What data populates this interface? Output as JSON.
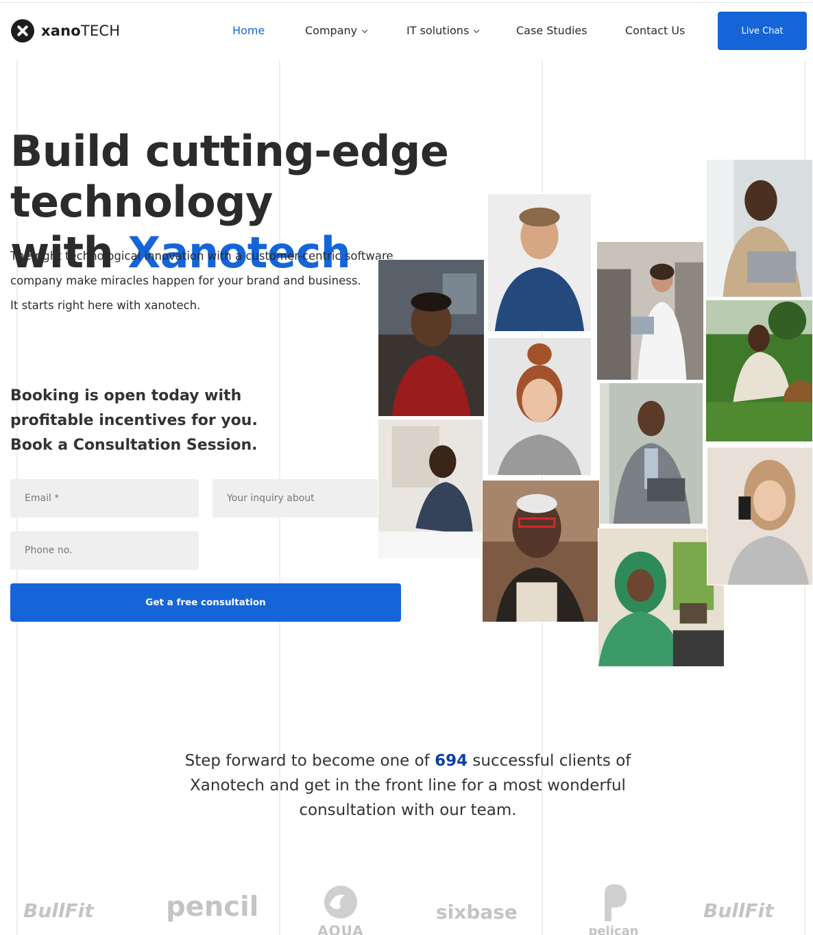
{
  "header": {
    "logo": {
      "bold": "xano",
      "light": "TECH"
    },
    "nav": [
      {
        "label": "Home",
        "active": true,
        "dropdown": false
      },
      {
        "label": "Company",
        "active": false,
        "dropdown": true
      },
      {
        "label": "IT solutions",
        "active": false,
        "dropdown": true
      },
      {
        "label": "Case Studies",
        "active": false,
        "dropdown": false
      },
      {
        "label": "Contact Us",
        "active": false,
        "dropdown": false
      }
    ],
    "live_chat": "Live Chat"
  },
  "hero": {
    "title_line1": "Build cutting-edge technology",
    "title_line2_prefix": "with ",
    "title_line2_accent": "Xanotech",
    "desc_line1": "The right technological innovation with a customer-centric software",
    "desc_line2": "company make miracles happen for your brand and business.",
    "desc_line3": "It starts right here with xanotech."
  },
  "booking": {
    "line1": "Booking is open today with",
    "line2": "profitable incentives for you.",
    "line3": "Book a Consultation Session."
  },
  "form": {
    "email_placeholder": "Email *",
    "inquiry_placeholder": "Your inquiry about",
    "phone_placeholder": "Phone no.",
    "submit": "Get a free consultation"
  },
  "clients": {
    "prefix": "Step forward to become one of ",
    "count": "694",
    "suffix": " successful clients of Xanotech and get in the front line for a most wonderful consultation with our team."
  },
  "brands": [
    "BullFit",
    "pencil",
    "AQUA",
    "sixbase",
    "pelican",
    "BullFit"
  ],
  "colors": {
    "accent": "#1565d8",
    "count": "#0d3ea8",
    "field_bg": "#efefef",
    "brand_gray": "#c4c4c4"
  }
}
